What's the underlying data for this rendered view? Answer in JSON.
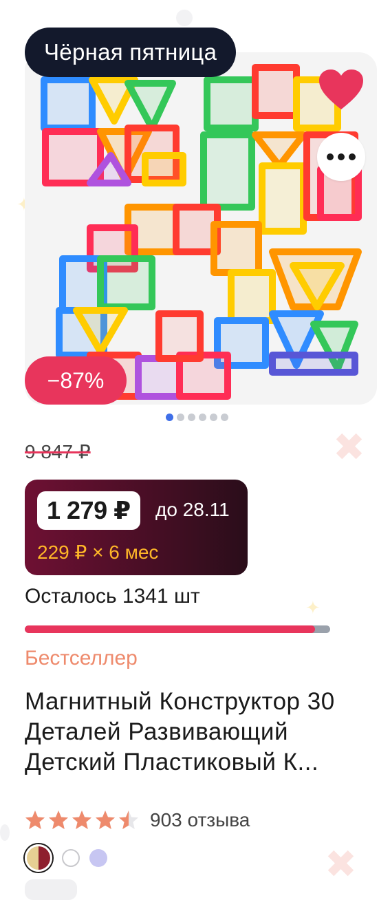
{
  "promo": {
    "label": "Чёрная пятница"
  },
  "image": {
    "description_icon": "magnetic-blocks-image",
    "slides": 6,
    "active_slide": 1
  },
  "actions": {
    "favorite_icon": "heart-icon",
    "more_icon": "more-dots-icon"
  },
  "discount": {
    "label": "−87%"
  },
  "price": {
    "old": "9 847 ₽",
    "current": "1 279 ₽",
    "until": "до 28.11",
    "installment": "229 ₽ × 6 мес"
  },
  "stock": {
    "text": "Осталось 1341 шт",
    "fill_fraction": 0.95
  },
  "badge": {
    "bestseller": "Бестселлер"
  },
  "product": {
    "title": "Магнитный Конструктор 30 Деталей Развивающий Детский Пластиковый К..."
  },
  "rating": {
    "value": 4.5,
    "max": 5,
    "reviews": "903 отзыва"
  },
  "colors": {
    "accent": "#e8355c",
    "dark": "#13192c",
    "bestseller": "#ee8a6c",
    "installment": "#ffb728",
    "star": "#ee8a6c",
    "swatches": [
      "#e6cf93/#8e1f2e",
      "#ffffff",
      "#c7c6f2"
    ]
  }
}
